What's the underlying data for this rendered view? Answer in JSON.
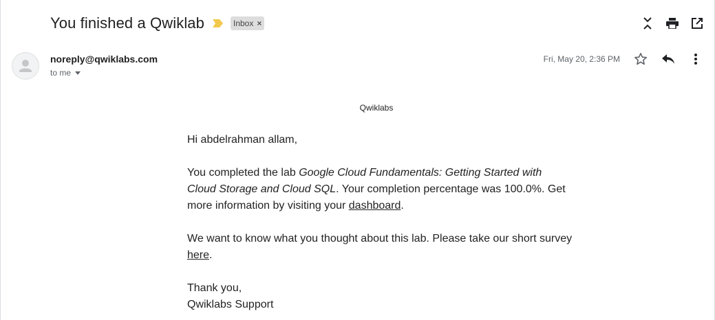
{
  "email": {
    "subject": "You finished a Qwiklab",
    "label": "Inbox",
    "label_remove": "×",
    "sender": "noreply@qwiklabs.com",
    "recipient": "to me",
    "date": "Fri, May 20, 2:36 PM"
  },
  "icons": {
    "importance": "importance-marker-icon",
    "collapse": "collapse-all-icon",
    "print": "print-icon",
    "open_new_window": "open-in-new-window-icon",
    "avatar": "person-avatar-icon",
    "star": "star-icon",
    "reply": "reply-icon",
    "more": "more-vertical-icon"
  },
  "colors": {
    "importance": "#f2c94c",
    "icon": "#5f6368"
  },
  "body": {
    "brand": "Qwiklabs",
    "greeting": "Hi abdelrahman allam,",
    "p1_pre": "You completed the lab ",
    "p1_lab": "Google Cloud Fundamentals: Getting Started with Cloud Storage and Cloud SQL",
    "p1_mid": ". Your completion percentage was 100.0%. Get more information by visiting your ",
    "p1_link": "dashboard",
    "p1_end": ".",
    "p2_pre": "We want to know what you thought about this lab. Please take our short survey ",
    "p2_link": "here",
    "p2_end": ".",
    "closing": "Thank you,",
    "signature": "Qwiklabs Support"
  }
}
